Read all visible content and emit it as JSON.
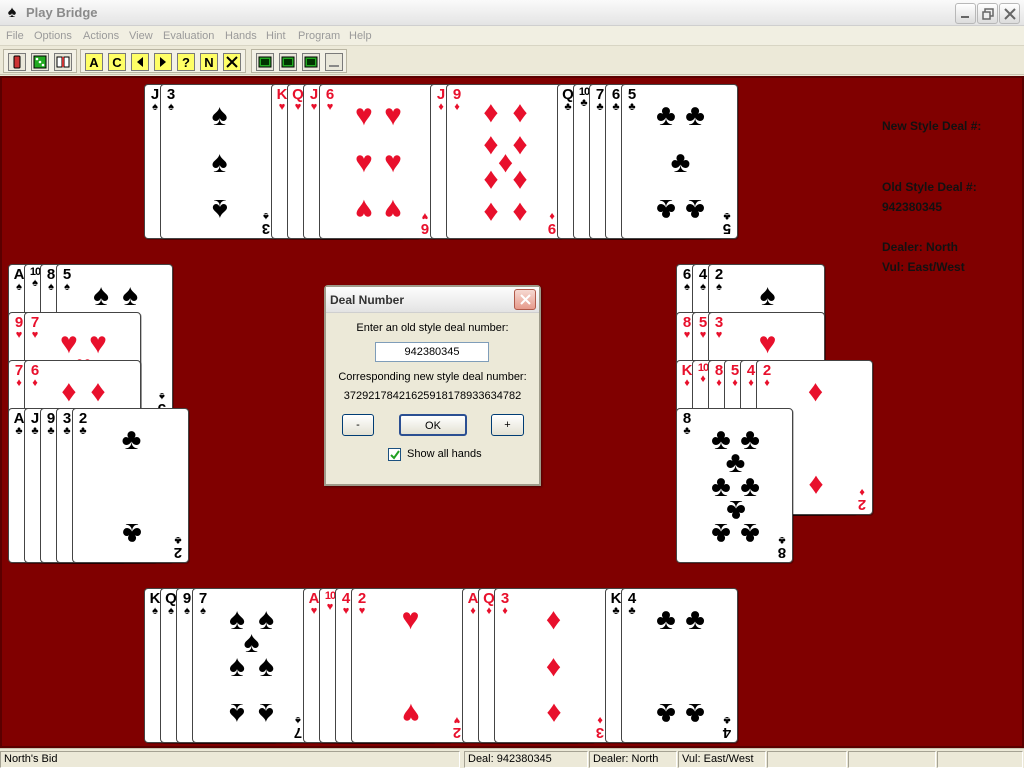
{
  "window": {
    "title": "Play Bridge",
    "icon": "spade-icon"
  },
  "menu": [
    "File",
    "Options",
    "Actions",
    "View",
    "Evaluation",
    "Hands",
    "Hint",
    "Program",
    "Help"
  ],
  "toolbar": {
    "letters": [
      "A",
      "C",
      "?",
      "N"
    ]
  },
  "info": {
    "new_style_label": "New Style Deal #:",
    "new_style_value": "",
    "old_style_label": "Old Style Deal #:",
    "old_style_value": "942380345",
    "dealer": "Dealer: North",
    "vul": "Vul: East/West"
  },
  "dialog": {
    "title": "Deal Number",
    "prompt": "Enter an old style deal number:",
    "input_value": "942380345",
    "corresponding_label": "Corresponding new style deal number:",
    "new_style_number": "37292178421625918178933634782",
    "minus_label": "-",
    "ok_label": "OK",
    "plus_label": "+",
    "show_all_label": "Show all hands",
    "show_all_checked": true
  },
  "hands": {
    "north": {
      "spades": [
        "J",
        "3"
      ],
      "hearts": [
        "K",
        "Q",
        "J",
        "6"
      ],
      "diamonds": [
        "J",
        "9"
      ],
      "clubs": [
        "Q",
        "10",
        "7",
        "6",
        "5"
      ]
    },
    "west": {
      "spades": [
        "A",
        "10",
        "8",
        "5"
      ],
      "hearts": [
        "9",
        "7"
      ],
      "diamonds": [
        "7",
        "6"
      ],
      "clubs": [
        "A",
        "J",
        "9",
        "3",
        "2"
      ]
    },
    "east": {
      "spades": [
        "6",
        "4",
        "2"
      ],
      "hearts": [
        "8",
        "5",
        "3"
      ],
      "diamonds": [
        "K",
        "10",
        "8",
        "5",
        "4",
        "2"
      ],
      "clubs": [
        "8"
      ]
    },
    "south": {
      "spades": [
        "K",
        "Q",
        "9",
        "7"
      ],
      "hearts": [
        "A",
        "10",
        "4",
        "2"
      ],
      "diamonds": [
        "A",
        "Q",
        "3"
      ],
      "clubs": [
        "K",
        "4"
      ]
    }
  },
  "status": {
    "message": "North's Bid",
    "deal": "Deal: 942380345",
    "dealer": "Dealer: North",
    "vul": "Vul: East/West"
  },
  "colors": {
    "table": "#800000",
    "red_suit": "#e8102c",
    "black_suit": "#000000"
  }
}
